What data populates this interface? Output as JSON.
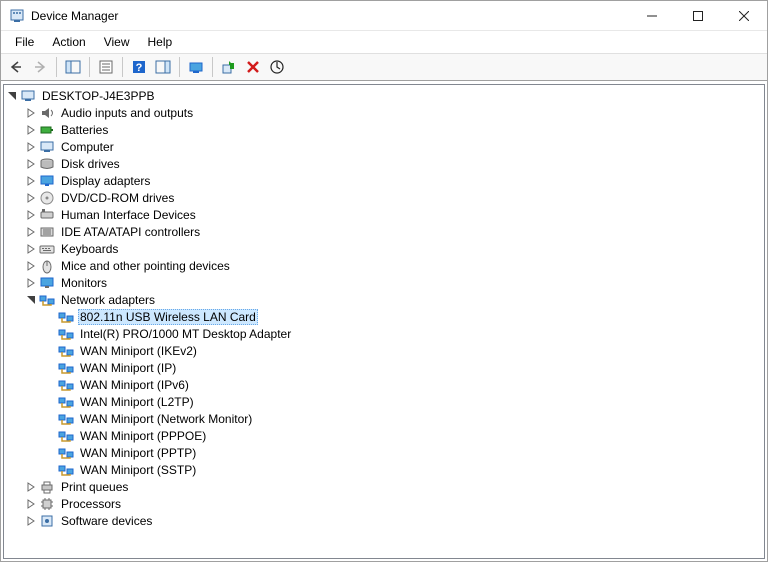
{
  "window": {
    "title": "Device Manager"
  },
  "menubar": {
    "file": "File",
    "action": "Action",
    "view": "View",
    "help": "Help"
  },
  "tree": {
    "root": {
      "label": "DESKTOP-J4E3PPB",
      "expanded": true
    },
    "categories": [
      {
        "label": "Audio inputs and outputs",
        "icon": "speaker",
        "expanded": false,
        "children": []
      },
      {
        "label": "Batteries",
        "icon": "battery",
        "expanded": false,
        "children": []
      },
      {
        "label": "Computer",
        "icon": "computer",
        "expanded": false,
        "children": []
      },
      {
        "label": "Disk drives",
        "icon": "disk",
        "expanded": false,
        "children": []
      },
      {
        "label": "Display adapters",
        "icon": "display",
        "expanded": false,
        "children": []
      },
      {
        "label": "DVD/CD-ROM drives",
        "icon": "cdrom",
        "expanded": false,
        "children": []
      },
      {
        "label": "Human Interface Devices",
        "icon": "hid",
        "expanded": false,
        "children": []
      },
      {
        "label": "IDE ATA/ATAPI controllers",
        "icon": "ide",
        "expanded": false,
        "children": []
      },
      {
        "label": "Keyboards",
        "icon": "keyboard",
        "expanded": false,
        "children": []
      },
      {
        "label": "Mice and other pointing devices",
        "icon": "mouse",
        "expanded": false,
        "children": []
      },
      {
        "label": "Monitors",
        "icon": "monitor",
        "expanded": false,
        "children": []
      },
      {
        "label": "Network adapters",
        "icon": "network",
        "expanded": true,
        "children": [
          {
            "label": "802.11n USB Wireless LAN Card",
            "icon": "network",
            "selected": true
          },
          {
            "label": "Intel(R) PRO/1000 MT Desktop Adapter",
            "icon": "network"
          },
          {
            "label": "WAN Miniport (IKEv2)",
            "icon": "network"
          },
          {
            "label": "WAN Miniport (IP)",
            "icon": "network"
          },
          {
            "label": "WAN Miniport (IPv6)",
            "icon": "network"
          },
          {
            "label": "WAN Miniport (L2TP)",
            "icon": "network"
          },
          {
            "label": "WAN Miniport (Network Monitor)",
            "icon": "network"
          },
          {
            "label": "WAN Miniport (PPPOE)",
            "icon": "network"
          },
          {
            "label": "WAN Miniport (PPTP)",
            "icon": "network"
          },
          {
            "label": "WAN Miniport (SSTP)",
            "icon": "network"
          }
        ]
      },
      {
        "label": "Print queues",
        "icon": "printer",
        "expanded": false,
        "children": []
      },
      {
        "label": "Processors",
        "icon": "processor",
        "expanded": false,
        "children": []
      },
      {
        "label": "Software devices",
        "icon": "software",
        "expanded": false,
        "children": []
      }
    ]
  }
}
